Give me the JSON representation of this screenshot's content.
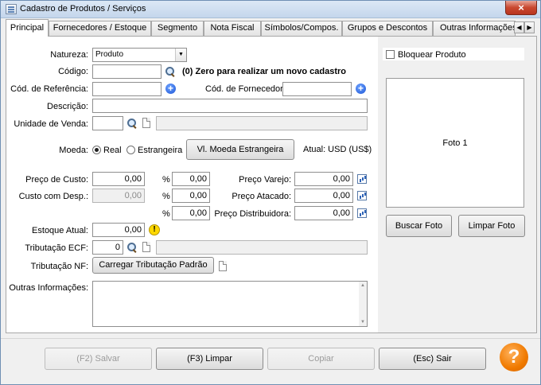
{
  "window": {
    "title": "Cadastro de Produtos / Serviços",
    "close_label": "×"
  },
  "tabs": [
    {
      "label": "Principal",
      "active": true
    },
    {
      "label": "Fornecedores / Estoque"
    },
    {
      "label": "Segmento"
    },
    {
      "label": "Nota Fiscal"
    },
    {
      "label": "Símbolos/Compos."
    },
    {
      "label": "Grupos e Descontos"
    },
    {
      "label": "Outras Informações"
    }
  ],
  "tab_scroll": {
    "left": "◀",
    "right": "▶"
  },
  "form": {
    "natureza_label": "Natureza:",
    "natureza_value": "Produto",
    "natureza_arrow": "▼",
    "codigo_label": "Código:",
    "codigo_value": "",
    "codigo_hint": "(0) Zero para realizar um novo cadastro",
    "cod_ref_label": "Cód. de Referência:",
    "cod_ref_value": "",
    "cod_forn_label": "Cód. de Fornecedor:",
    "cod_forn_value": "",
    "descricao_label": "Descrição:",
    "descricao_value": "",
    "unidade_label": "Unidade de Venda:",
    "unidade_value": "",
    "unidade_desc": "",
    "moeda_label": "Moeda:",
    "moeda_real": "Real",
    "moeda_estrangeira": "Estrangeira",
    "moeda_selected": "Real",
    "vl_moeda_button": "Vl. Moeda Estrangeira",
    "atual_text": "Atual: USD (US$)",
    "preco_custo_label": "Preço de Custo:",
    "preco_custo_value": "0,00",
    "custo_desp_label": "Custo com Desp.:",
    "custo_desp_value": "0,00",
    "percent_sign": "%",
    "perc_varejo": "0,00",
    "perc_atacado": "0,00",
    "perc_distribuidora": "0,00",
    "preco_varejo_label": "Preço Varejo:",
    "preco_varejo_value": "0,00",
    "preco_atacado_label": "Preço Atacado:",
    "preco_atacado_value": "0,00",
    "preco_distribuidora_label": "Preço Distribuidora:",
    "preco_distribuidora_value": "0,00",
    "estoque_label": "Estoque Atual:",
    "estoque_value": "0,00",
    "trib_ecf_label": "Tributação ECF:",
    "trib_ecf_value": "0",
    "trib_ecf_desc": "",
    "trib_nf_label": "Tributação NF:",
    "trib_nf_button": "Carregar Tributação Padrão",
    "outras_label": "Outras Informações:",
    "outras_value": ""
  },
  "photo": {
    "bloquear_label": "Bloquear Produto",
    "bloquear_checked": false,
    "foto_label": "Foto 1",
    "buscar_button": "Buscar Foto",
    "limpar_button": "Limpar Foto"
  },
  "footer": {
    "salvar": "(F2) Salvar",
    "salvar_enabled": false,
    "limpar": "(F3) Limpar",
    "copiar": "Copiar",
    "copiar_enabled": false,
    "sair": "(Esc) Sair",
    "help": "?"
  },
  "colors": {
    "title_gradient_top": "#dce8f5",
    "close_red": "#c9482f",
    "help_orange": "#f07a00",
    "plus_blue": "#1c55d6",
    "warn_yellow": "#ffd800"
  }
}
